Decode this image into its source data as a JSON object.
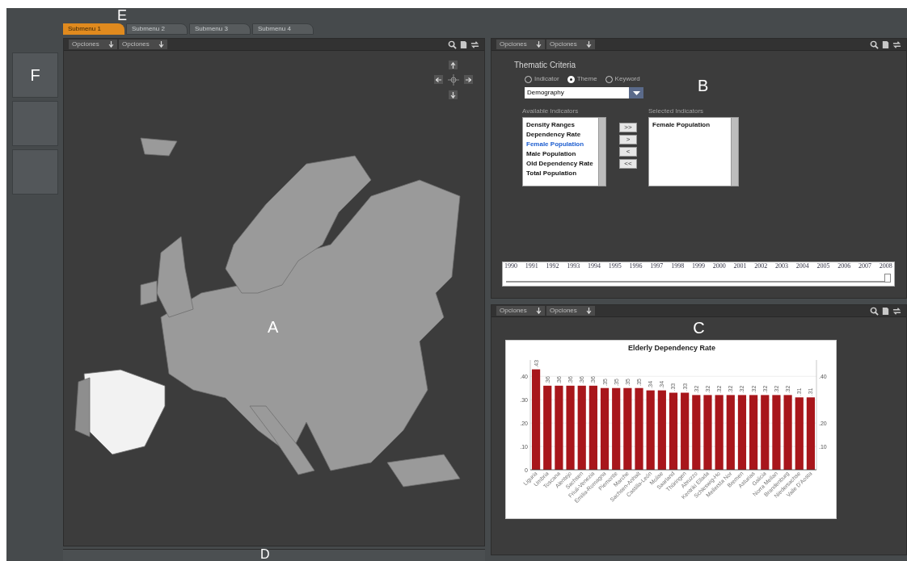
{
  "tabs": [
    {
      "label": "Submenu 1",
      "selected": true
    },
    {
      "label": "Submenu 2",
      "selected": false
    },
    {
      "label": "Submenu 3",
      "selected": false
    },
    {
      "label": "Submenu 4",
      "selected": false
    }
  ],
  "tabs_annotation": "E",
  "sidebar": {
    "buttons": [
      {
        "kind": "labeled",
        "label": "F"
      },
      {
        "kind": "blank"
      },
      {
        "kind": "blank"
      }
    ]
  },
  "map_panel": {
    "toolbar": {
      "dropdowns": [
        "Opciones",
        "Opciones"
      ]
    },
    "annotation": "A"
  },
  "bottom_bar": {
    "annotation": "D"
  },
  "criteria_panel": {
    "toolbar": {
      "dropdowns": [
        "Opciones",
        "Opciones"
      ]
    },
    "annotation": "B",
    "title": "Thematic Criteria",
    "search_by": [
      {
        "label": "Indicator",
        "selected": false
      },
      {
        "label": "Theme",
        "selected": true
      },
      {
        "label": "Keyword",
        "selected": false
      }
    ],
    "theme_dropdown": {
      "value": "Demography"
    },
    "available": {
      "heading": "Available Indicators",
      "items": [
        {
          "label": "Density Ranges",
          "selected": false
        },
        {
          "label": "Dependency Rate",
          "selected": false
        },
        {
          "label": "Female Population",
          "selected": true
        },
        {
          "label": "Male Population",
          "selected": false
        },
        {
          "label": "Old Dependency Rate",
          "selected": false
        },
        {
          "label": "Total Population",
          "selected": false
        }
      ]
    },
    "move_buttons": [
      ">>",
      ">",
      "<",
      "<<"
    ],
    "selected": {
      "heading": "Selected Indicators",
      "items": [
        "Female Population"
      ]
    },
    "timeline": {
      "years": [
        "1990",
        "1991",
        "1992",
        "1993",
        "1994",
        "1995",
        "1996",
        "1997",
        "1998",
        "1999",
        "2000",
        "2001",
        "2002",
        "2003",
        "2004",
        "2005",
        "2006",
        "2007",
        "2008"
      ],
      "level": 1
    }
  },
  "chart_panel": {
    "toolbar": {
      "dropdowns": [
        "Opciones",
        "Opciones"
      ]
    },
    "annotation": "C",
    "chart_data": {
      "type": "bar",
      "title": "Elderly Dependency Rate",
      "categories": [
        "Liguria",
        "Umbria",
        "Toscana",
        "Alentejo",
        "Sachsen",
        "Friuli-Venezia",
        "Emilia-Romagna",
        "Piemonte",
        "Marche",
        "Sachsen-Anhalt",
        "Castilla-León",
        "Molise",
        "Saarland",
        "Thüringen",
        "Abruzzo",
        "Kentriki Ellada",
        "Schleswig-Ho",
        "Mellersta Nor",
        "Bremen",
        "Asturias",
        "Galicia",
        "Norra Mellan",
        "Brandenburg",
        "Niedersachse",
        "Valle D'Aosta"
      ],
      "series": [
        {
          "color": "#a8161b",
          "values": [
            0.43,
            0.36,
            0.36,
            0.36,
            0.36,
            0.36,
            0.35,
            0.35,
            0.35,
            0.35,
            0.34,
            0.34,
            0.33,
            0.33,
            0.32,
            0.32,
            0.32,
            0.32,
            0.32,
            0.32,
            0.32,
            0.32,
            0.32,
            0.31,
            0.31
          ]
        }
      ],
      "value_labels": [
        ".43",
        ".36",
        ".36",
        ".36",
        ".36",
        ".36",
        ".35",
        ".35",
        ".35",
        ".35",
        ".34",
        ".34",
        ".33",
        ".33",
        ".32",
        ".32",
        ".32",
        ".32",
        ".32",
        ".32",
        ".32",
        ".32",
        ".32",
        ".31",
        ".31"
      ],
      "ylim": [
        0,
        0.47
      ],
      "yticks": [
        {
          "value": 0,
          "label": "0"
        },
        {
          "value": 0.1,
          "label": ".10"
        },
        {
          "value": 0.2,
          "label": ".20"
        },
        {
          "value": 0.3,
          "label": ".30"
        },
        {
          "value": 0.4,
          "label": ".40"
        }
      ],
      "y2lim": [
        0,
        0.47
      ],
      "y2ticks": [
        {
          "value": 0.1,
          "label": ".10"
        },
        {
          "value": 0.2,
          "label": ".20"
        },
        {
          "value": 0.4,
          "label": ".40"
        }
      ],
      "grid": true
    }
  }
}
